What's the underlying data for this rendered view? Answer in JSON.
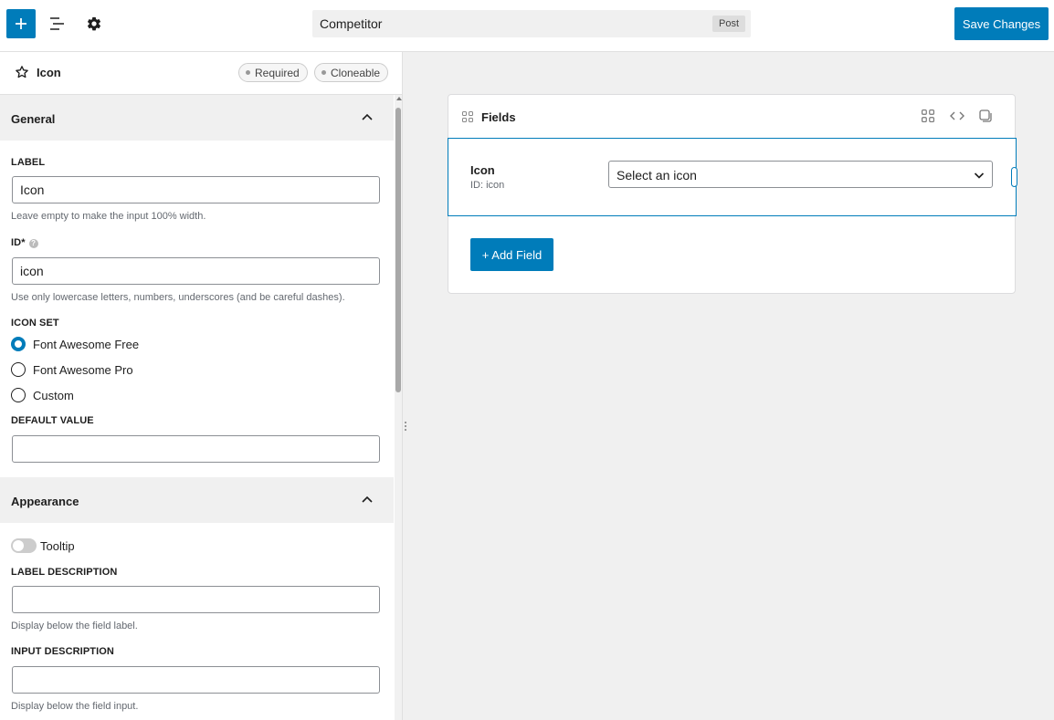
{
  "topbar": {
    "post_title": "Competitor",
    "post_type": "Post",
    "save_label": "Save Changes"
  },
  "sidebar": {
    "field_title": "Icon",
    "badges": [
      "Required",
      "Cloneable"
    ],
    "general": {
      "title": "General",
      "label_caption": "LABEL",
      "label_value": "Icon",
      "label_help": "Leave empty to make the input 100% width.",
      "id_caption": "ID*",
      "id_value": "icon",
      "id_help": "Use only lowercase letters, numbers, underscores (and be careful dashes).",
      "icon_set_caption": "ICON SET",
      "icon_set_options": [
        "Font Awesome Free",
        "Font Awesome Pro",
        "Custom"
      ],
      "icon_set_selected": "Font Awesome Free",
      "default_caption": "DEFAULT VALUE",
      "default_value": ""
    },
    "appearance": {
      "title": "Appearance",
      "tooltip_label": "Tooltip",
      "tooltip_enabled": false,
      "label_desc_caption": "LABEL DESCRIPTION",
      "label_desc_help": "Display below the field label.",
      "input_desc_caption": "INPUT DESCRIPTION",
      "input_desc_help": "Display below the field input."
    }
  },
  "canvas": {
    "card_title": "Fields",
    "field": {
      "label": "Icon",
      "id_text": "ID: icon",
      "select_placeholder": "Select an icon"
    },
    "add_field_label": "+ Add Field"
  },
  "colors": {
    "accent": "#007cba",
    "background": "#f0f0f0"
  }
}
